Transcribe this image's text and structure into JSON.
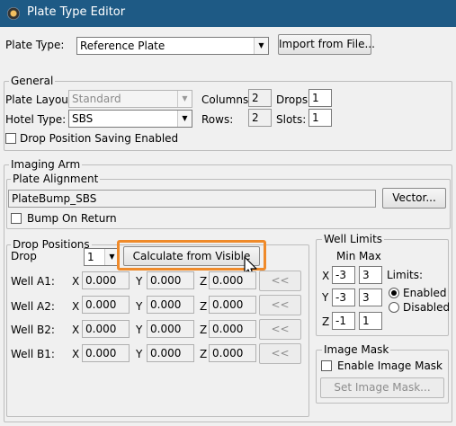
{
  "window": {
    "title": "Plate Type Editor"
  },
  "top": {
    "plate_type_label": "Plate Type:",
    "plate_type_value": "Reference Plate",
    "import_button": "Import from File..."
  },
  "general": {
    "title": "General",
    "plate_layout_label": "Plate Layout:",
    "plate_layout_value": "Standard",
    "hotel_type_label": "Hotel Type:",
    "hotel_type_value": "SBS",
    "columns_label": "Columns:",
    "columns_value": "2",
    "rows_label": "Rows:",
    "rows_value": "2",
    "drops_label": "Drops:",
    "drops_value": "1",
    "slots_label": "Slots:",
    "slots_value": "1",
    "drop_saving_label": "Drop Position Saving Enabled",
    "drop_saving_checked": false
  },
  "imaging_arm": {
    "title": "Imaging Arm",
    "plate_alignment": {
      "title": "Plate Alignment",
      "value": "PlateBump_SBS",
      "vector_button": "Vector...",
      "bump_label": "Bump On Return",
      "bump_checked": false
    },
    "drop_positions": {
      "title": "Drop Positions",
      "drop_label": "Drop",
      "drop_value": "1",
      "calculate_button": "Calculate from Visible",
      "copy_button": "<<",
      "rows": [
        {
          "label": "Well A1:",
          "x": "0.000",
          "y": "0.000",
          "z": "0.000"
        },
        {
          "label": "Well A2:",
          "x": "0.000",
          "y": "0.000",
          "z": "0.000"
        },
        {
          "label": "Well B2:",
          "x": "0.000",
          "y": "0.000",
          "z": "0.000"
        },
        {
          "label": "Well B1:",
          "x": "0.000",
          "y": "0.000",
          "z": "0.000"
        }
      ],
      "axis_x": "X",
      "axis_y": "Y",
      "axis_z": "Z"
    },
    "well_limits": {
      "title": "Well Limits",
      "min_label": "Min",
      "max_label": "Max",
      "x_label": "X",
      "x_min": "-3",
      "x_max": "3",
      "y_label": "Y",
      "y_min": "-3",
      "y_max": "3",
      "z_label": "Z",
      "z_min": "-1",
      "z_max": "1",
      "limits_label": "Limits:",
      "enabled_label": "Enabled",
      "disabled_label": "Disabled",
      "selected": "Enabled"
    },
    "image_mask": {
      "title": "Image Mask",
      "enable_label": "Enable Image Mask",
      "enable_checked": false,
      "set_button": "Set Image Mask..."
    }
  },
  "colors": {
    "titlebar": "#1e5a85",
    "highlight": "#ef8a2a"
  }
}
